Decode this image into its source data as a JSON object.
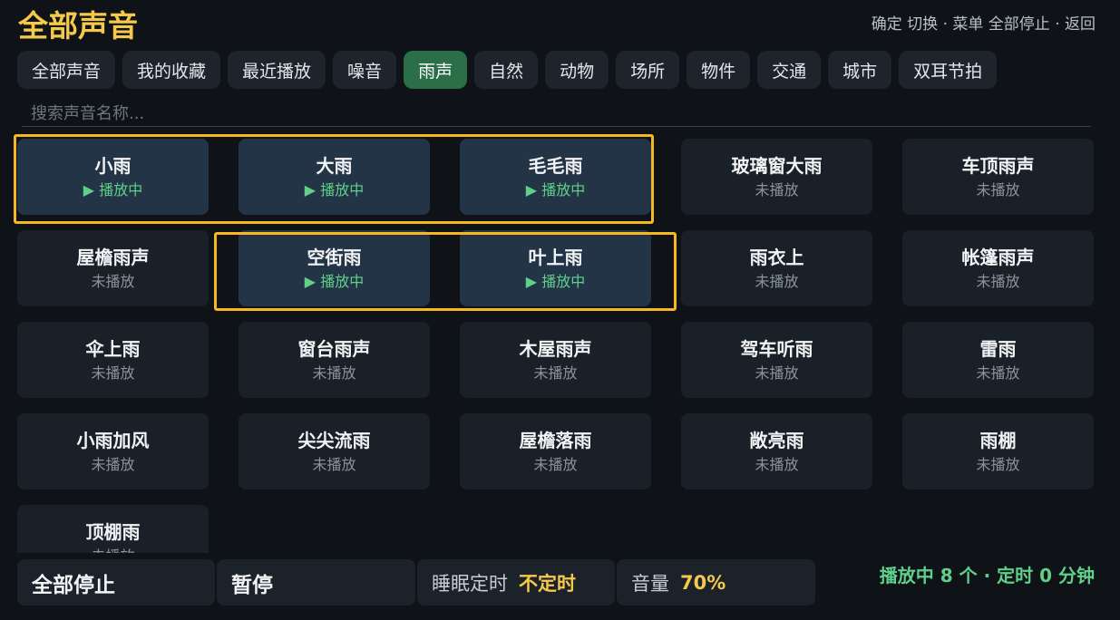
{
  "header": {
    "title": "全部声音",
    "hints": "确定 切换 · 菜单 全部停止 · 返回"
  },
  "tabs": [
    {
      "label": "全部声音"
    },
    {
      "label": "我的收藏"
    },
    {
      "label": "最近播放"
    },
    {
      "label": "噪音"
    },
    {
      "label": "雨声",
      "active": true
    },
    {
      "label": "自然"
    },
    {
      "label": "动物"
    },
    {
      "label": "场所"
    },
    {
      "label": "物件"
    },
    {
      "label": "交通"
    },
    {
      "label": "城市"
    },
    {
      "label": "双耳节拍"
    }
  ],
  "search": {
    "placeholder": "搜索声音名称..."
  },
  "status_labels": {
    "playing": "▶ 播放中",
    "idle": "未播放"
  },
  "sounds": [
    {
      "name": "小雨",
      "status": "▶ 播放中",
      "playing": true
    },
    {
      "name": "大雨",
      "status": "▶ 播放中",
      "playing": true
    },
    {
      "name": "毛毛雨",
      "status": "▶ 播放中",
      "playing": true
    },
    {
      "name": "玻璃窗大雨",
      "status": "未播放",
      "playing": false
    },
    {
      "name": "车顶雨声",
      "status": "未播放",
      "playing": false
    },
    {
      "name": "屋檐雨声",
      "status": "未播放",
      "playing": false
    },
    {
      "name": "空街雨",
      "status": "▶ 播放中",
      "playing": true
    },
    {
      "name": "叶上雨",
      "status": "▶ 播放中",
      "playing": true
    },
    {
      "name": "雨衣上",
      "status": "未播放",
      "playing": false
    },
    {
      "name": "帐篷雨声",
      "status": "未播放",
      "playing": false
    },
    {
      "name": "伞上雨",
      "status": "未播放",
      "playing": false
    },
    {
      "name": "窗台雨声",
      "status": "未播放",
      "playing": false
    },
    {
      "name": "木屋雨声",
      "status": "未播放",
      "playing": false
    },
    {
      "name": "驾车听雨",
      "status": "未播放",
      "playing": false
    },
    {
      "name": "雷雨",
      "status": "未播放",
      "playing": false
    },
    {
      "name": "小雨加风",
      "status": "未播放",
      "playing": false
    },
    {
      "name": "尖尖流雨",
      "status": "未播放",
      "playing": false
    },
    {
      "name": "屋檐落雨",
      "status": "未播放",
      "playing": false
    },
    {
      "name": "敞亮雨",
      "status": "未播放",
      "playing": false
    },
    {
      "name": "雨棚",
      "status": "未播放",
      "playing": false
    },
    {
      "name": "顶棚雨",
      "status": "未播放",
      "playing": false
    }
  ],
  "bottom_bar": {
    "stop_all": "全部停止",
    "pause": "暂停",
    "sleep_label": "睡眠定时",
    "sleep_value": "不定时",
    "volume_label": "音量",
    "volume_value": "70%"
  },
  "status_line": "播放中 8 个 · 定时 0 分钟",
  "colors": {
    "accent": "#f5c94a",
    "active_tab": "#2c6e48",
    "playing_card": "#243447",
    "playing_text": "#5fd08a",
    "selection": "#f5b820"
  }
}
